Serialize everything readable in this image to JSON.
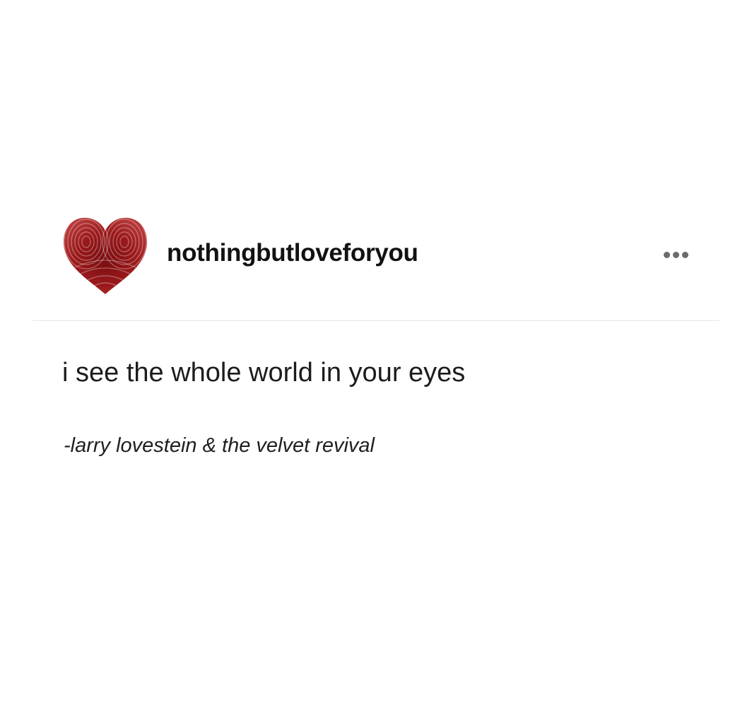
{
  "post": {
    "avatar_icon": "fingerprint-heart-icon",
    "username": "nothingbutloveforyou",
    "more_icon": "more-options-icon",
    "quote": "i see the whole world in your eyes",
    "attribution": "-larry lovestein & the velvet revival"
  },
  "colors": {
    "heart": "#9b1a1c",
    "heart_dark": "#6e0c0f",
    "text": "#1c1c1c",
    "divider": "#e6e6e6",
    "dots": "#6b6b6b"
  }
}
